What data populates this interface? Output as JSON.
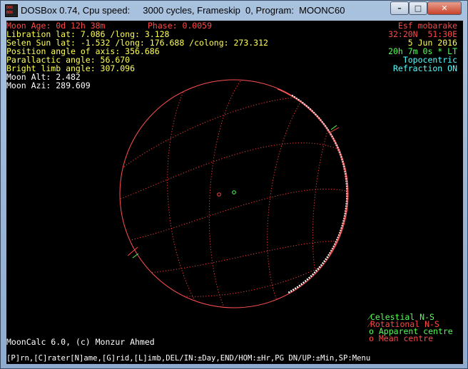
{
  "window": {
    "title": "DOSBox 0.74, Cpu speed:     3000 cycles, Frameskip  0, Program:  MOONC60",
    "icon_label_top": "DOS",
    "icon_label_bottom": "BOX",
    "minimize_glyph": "–",
    "maximize_glyph": "□",
    "close_glyph": "✕"
  },
  "left_info": {
    "moon_age": "Moon Age: 0d 12h 38m",
    "phase": "Phase: 0.0059",
    "libration": "Libration lat: 7.086 /long: 3.128",
    "selen_sun": "Selen Sun lat: -1.532 /long: 176.688 /colong: 273.312",
    "position_angle": "Position angle of axis: 356.686",
    "parallactic": "Parallactic angle: 56.670",
    "bright_limb": "Bright limb angle: 307.096",
    "moon_alt": "Moon Alt: 2.482",
    "moon_azi": "Moon Azi: 289.609"
  },
  "right_info": {
    "location": "Esf mobarake",
    "coords": "32:20N  51:30E",
    "date": "5 Jun 2016",
    "time": "20h 7m 0s * LT",
    "mode": "Topocentric",
    "refraction": "Refraction ON"
  },
  "legend": {
    "celestial": "Celestial N-S",
    "rotational": "Rotational N-S",
    "apparent": "Apparent centre",
    "mean": "Mean centre",
    "celestial_mark": "⁄",
    "rotational_mark": "⁄",
    "apparent_mark": "o",
    "mean_mark": "o"
  },
  "credit": "MoonCalc 6.0, (c) Monzur Ahmed",
  "menu_bar": "[P]rn,[C]rater[N]ame,[G]rid,[L]imb,DEL/IN:±Day,END/HOM:±Hr,PG DN/UP:±Min,SP:Menu",
  "colors": {
    "red": "#ff4747",
    "yellow": "#ffff55",
    "white": "#ffffff",
    "cyan": "#55ffff",
    "green": "#55ff55"
  }
}
